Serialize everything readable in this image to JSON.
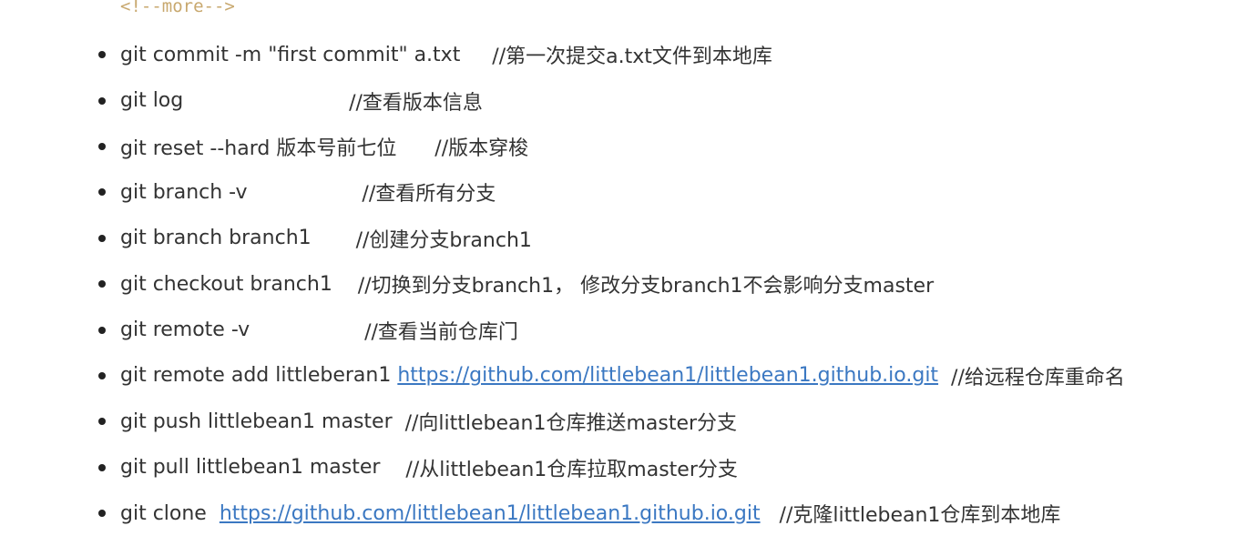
{
  "colors": {
    "text": "#333333",
    "link": "#3b78c2",
    "comment": "#c8a86e",
    "bullet": "#222222"
  },
  "top_comment": "<!--more-->",
  "commands": [
    {
      "cmd": "git commit -m \"first commit\" a.txt     ",
      "comment": "//第一次提交a.txt文件到本地库"
    },
    {
      "cmd": "git log                          ",
      "comment": "//查看版本信息"
    },
    {
      "cmd": "git reset --hard 版本号前七位      ",
      "comment": "//版本穿梭"
    },
    {
      "cmd": "git branch -v                  ",
      "comment": "//查看所有分支"
    },
    {
      "cmd": "git branch branch1       ",
      "comment": "//创建分支branch1"
    },
    {
      "cmd": "git checkout branch1    ",
      "comment": "//切换到分支branch1， 修改分支branch1不会影响分支master"
    },
    {
      "cmd": "git remote -v                  ",
      "comment": "//查看当前仓库门"
    },
    {
      "cmd": "git remote add littleberan1 ",
      "link": "https://github.com/littlebean1/littlebean1.github.io.git",
      "comment": "  //给远程仓库重命名"
    },
    {
      "cmd": "git push littlebean1 master  ",
      "comment": "//向littlebean1仓库推送master分支"
    },
    {
      "cmd": "git pull littlebean1 master    ",
      "comment": "//从littlebean1仓库拉取master分支"
    },
    {
      "cmd": "git clone  ",
      "link": "https://github.com/littlebean1/littlebean1.github.io.git",
      "comment": "   //克隆littlebean1仓库到本地库"
    }
  ]
}
